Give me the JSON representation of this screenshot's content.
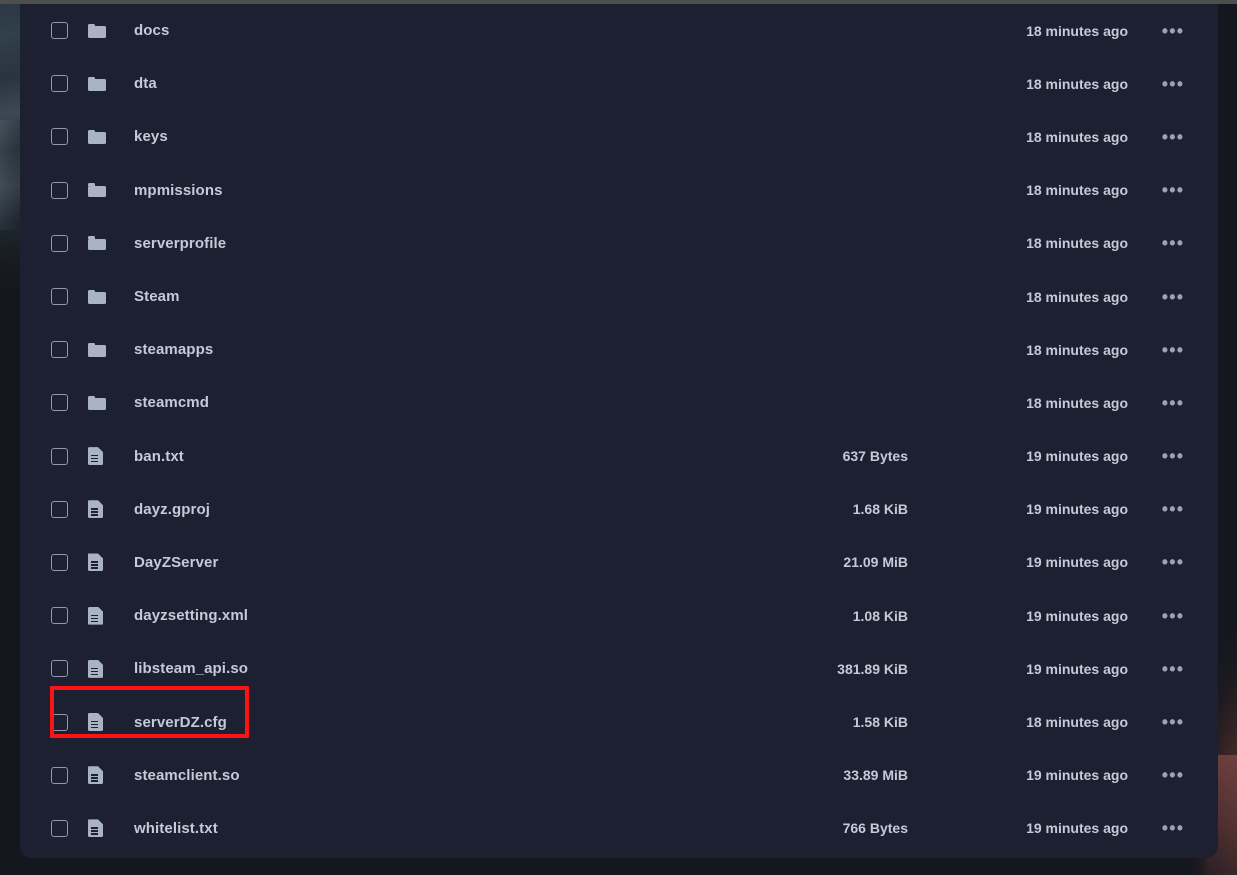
{
  "window": {
    "background_color": "#15171f",
    "panel_color": "#1d2030",
    "text_color": "#c3cad9",
    "highlight_color": "#fa1414",
    "top_strip_color": "#4d4f4d"
  },
  "file_list": {
    "menu_glyph": "•••",
    "rows": [
      {
        "name": "docs",
        "type": "folder",
        "icon": "folder-icon",
        "size": "",
        "modified": "18 minutes ago",
        "highlighted": false
      },
      {
        "name": "dta",
        "type": "folder",
        "icon": "folder-icon",
        "size": "",
        "modified": "18 minutes ago",
        "highlighted": false
      },
      {
        "name": "keys",
        "type": "folder",
        "icon": "folder-icon",
        "size": "",
        "modified": "18 minutes ago",
        "highlighted": false
      },
      {
        "name": "mpmissions",
        "type": "folder",
        "icon": "folder-icon",
        "size": "",
        "modified": "18 minutes ago",
        "highlighted": false
      },
      {
        "name": "serverprofile",
        "type": "folder",
        "icon": "folder-icon",
        "size": "",
        "modified": "18 minutes ago",
        "highlighted": false
      },
      {
        "name": "Steam",
        "type": "folder",
        "icon": "folder-icon",
        "size": "",
        "modified": "18 minutes ago",
        "highlighted": false
      },
      {
        "name": "steamapps",
        "type": "folder",
        "icon": "folder-icon",
        "size": "",
        "modified": "18 minutes ago",
        "highlighted": false
      },
      {
        "name": "steamcmd",
        "type": "folder",
        "icon": "folder-icon",
        "size": "",
        "modified": "18 minutes ago",
        "highlighted": false
      },
      {
        "name": "ban.txt",
        "type": "file",
        "icon": "file-icon",
        "size": "637 Bytes",
        "modified": "19 minutes ago",
        "highlighted": false
      },
      {
        "name": "dayz.gproj",
        "type": "file",
        "icon": "file-icon",
        "size": "1.68 KiB",
        "modified": "19 minutes ago",
        "highlighted": false
      },
      {
        "name": "DayZServer",
        "type": "file",
        "icon": "file-icon",
        "size": "21.09 MiB",
        "modified": "19 minutes ago",
        "highlighted": false
      },
      {
        "name": "dayzsetting.xml",
        "type": "file",
        "icon": "file-icon",
        "size": "1.08 KiB",
        "modified": "19 minutes ago",
        "highlighted": false
      },
      {
        "name": "libsteam_api.so",
        "type": "file",
        "icon": "file-icon",
        "size": "381.89 KiB",
        "modified": "19 minutes ago",
        "highlighted": false
      },
      {
        "name": "serverDZ.cfg",
        "type": "file",
        "icon": "file-icon",
        "size": "1.58 KiB",
        "modified": "18 minutes ago",
        "highlighted": true
      },
      {
        "name": "steamclient.so",
        "type": "file",
        "icon": "file-icon",
        "size": "33.89 MiB",
        "modified": "19 minutes ago",
        "highlighted": false
      },
      {
        "name": "whitelist.txt",
        "type": "file",
        "icon": "file-icon",
        "size": "766 Bytes",
        "modified": "19 minutes ago",
        "highlighted": false
      }
    ]
  }
}
